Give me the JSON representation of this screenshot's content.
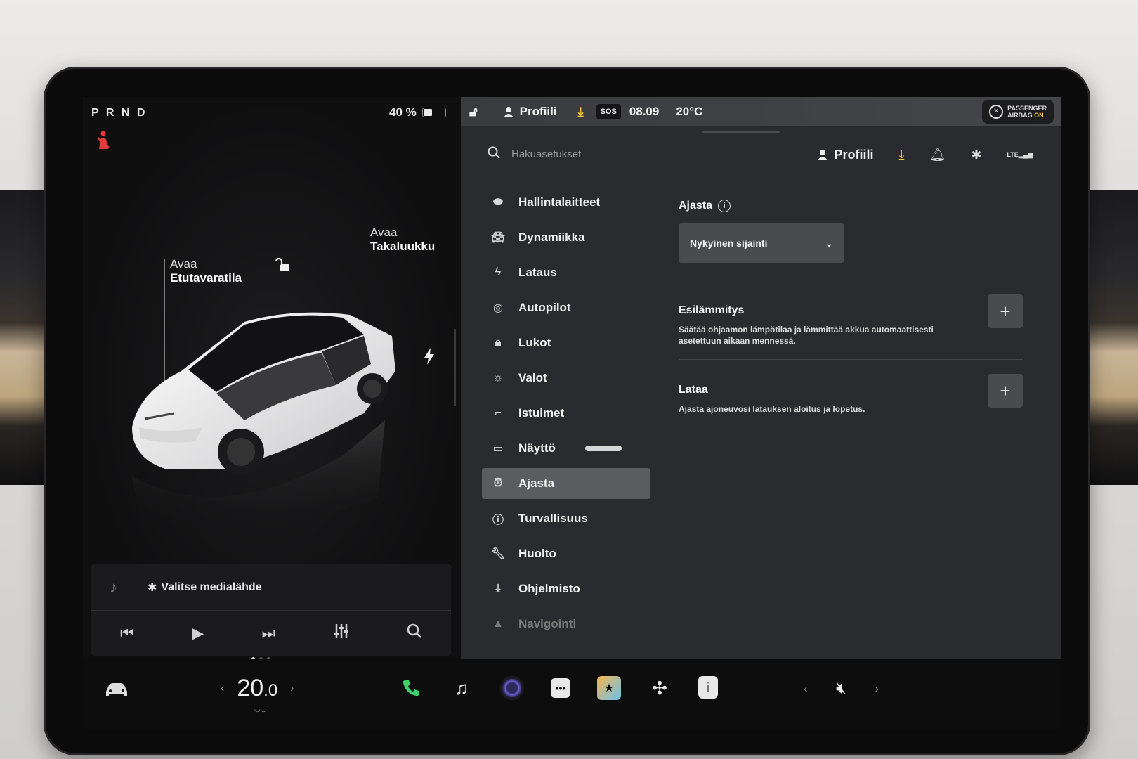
{
  "gear": "P R N D",
  "battery": {
    "percent_label": "40 %",
    "level": 0.4
  },
  "left": {
    "front_trunk": {
      "action": "Avaa",
      "name": "Etutavaratila"
    },
    "rear_trunk": {
      "action": "Avaa",
      "name": "Takaluukku"
    },
    "media": {
      "source_label": "Valitse medialähde",
      "controls": [
        "previous-track",
        "play",
        "next-track",
        "equalizer",
        "search"
      ]
    }
  },
  "status_bar": {
    "profile": "Profiili",
    "sos": "SOS",
    "time": "08.09",
    "temperature": "20°C",
    "airbag_line1": "PASSENGER",
    "airbag_line2": "AIRBAG",
    "airbag_state": "ON"
  },
  "search": {
    "placeholder": "Hakuasetukset",
    "profile": "Profiili",
    "lte": "LTE"
  },
  "menu": [
    {
      "label": "Hallintalaitteet",
      "icon": "toggle-icon"
    },
    {
      "label": "Dynamiikka",
      "icon": "car-front-icon"
    },
    {
      "label": "Lataus",
      "icon": "bolt-icon"
    },
    {
      "label": "Autopilot",
      "icon": "steering-wheel-icon"
    },
    {
      "label": "Lukot",
      "icon": "lock-icon"
    },
    {
      "label": "Valot",
      "icon": "sun-icon"
    },
    {
      "label": "Istuimet",
      "icon": "seat-icon"
    },
    {
      "label": "Näyttö",
      "icon": "display-icon"
    },
    {
      "label": "Ajasta",
      "icon": "alarm-clock-icon",
      "active": true
    },
    {
      "label": "Turvallisuus",
      "icon": "alert-circle-icon"
    },
    {
      "label": "Huolto",
      "icon": "wrench-icon"
    },
    {
      "label": "Ohjelmisto",
      "icon": "download-icon"
    },
    {
      "label": "Navigointi",
      "icon": "navigation-icon"
    }
  ],
  "content": {
    "title": "Ajasta",
    "location_dropdown": "Nykyinen sijainti",
    "preconditioning": {
      "title": "Esilämmitys",
      "description": "Säätää ohjaamon lämpötilaa ja lämmittää akkua automaattisesti asetettuun aikaan mennessä."
    },
    "charge": {
      "title": "Lataa",
      "description": "Ajasta ajoneuvosi latauksen aloitus ja lopetus."
    }
  },
  "dock": {
    "temp_whole": "20",
    "temp_decimal": ".0",
    "apps": [
      "phone-icon",
      "music-icon",
      "camera-icon",
      "more-icon",
      "toybox-icon",
      "fan-icon",
      "release-notes-icon"
    ]
  },
  "colors": {
    "accent_yellow": "#f5c13d",
    "phone_green": "#3ed06b",
    "seatbelt_red": "#e23b3b",
    "active_menu": "#5b5c60"
  }
}
